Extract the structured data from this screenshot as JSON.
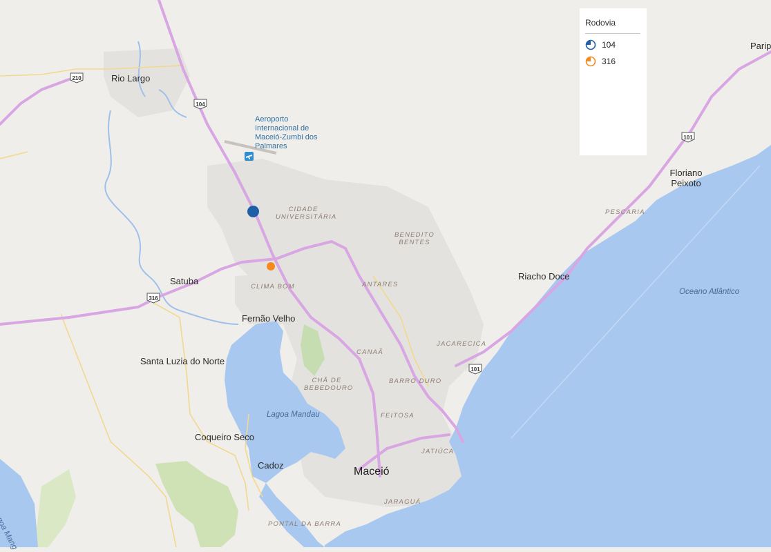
{
  "legend": {
    "title": "Rodovia",
    "items": [
      {
        "label": "104",
        "color": "#1f5fa8"
      },
      {
        "label": "316",
        "color": "#f28a1e"
      }
    ]
  },
  "places": {
    "rio_largo": "Rio Largo",
    "paripueira": "Parip",
    "floriano_peixoto": "Floriano Peixoto",
    "satuba": "Satuba",
    "riacho_doce": "Riacho Doce",
    "fernao_velho": "Fernão Velho",
    "santa_luzia": "Santa Luzia do Norte",
    "coqueiro_seco": "Coqueiro Seco",
    "cadoz": "Cadoz",
    "maceio": "Maceió"
  },
  "neighborhoods": {
    "cidade_universitaria": "Cidade Universitária",
    "benedito_bentes": "Benedito Bentes",
    "clima_bom": "Clima Bom",
    "antares": "Antares",
    "pescaria": "Pescaria",
    "jacarecica": "Jacarecica",
    "canaa": "Canaã",
    "cha_de_bebedouro": "Chã de Bebedouro",
    "barro_duro": "Barro Duro",
    "feitosa": "Feitosa",
    "jatiuca": "Jatiúca",
    "jaragua": "Jaraguá",
    "pontal_da_barra": "Pontal da Barra"
  },
  "water": {
    "ocean": "Oceano Atlântico",
    "lagoa_mandau": "Lagoa Mandau",
    "lagoa_manguaba": "Lagoa Mang"
  },
  "airport": {
    "name": "Aeroporto Internacional de Maceió-Zumbi dos Palmares"
  },
  "shields": {
    "r210": "210",
    "r104": "104",
    "r101_north": "101",
    "r316": "316",
    "r101_south": "101"
  },
  "markers": [
    {
      "route": "104",
      "color": "#1f5fa8"
    },
    {
      "route": "316",
      "color": "#f28a1e"
    }
  ]
}
